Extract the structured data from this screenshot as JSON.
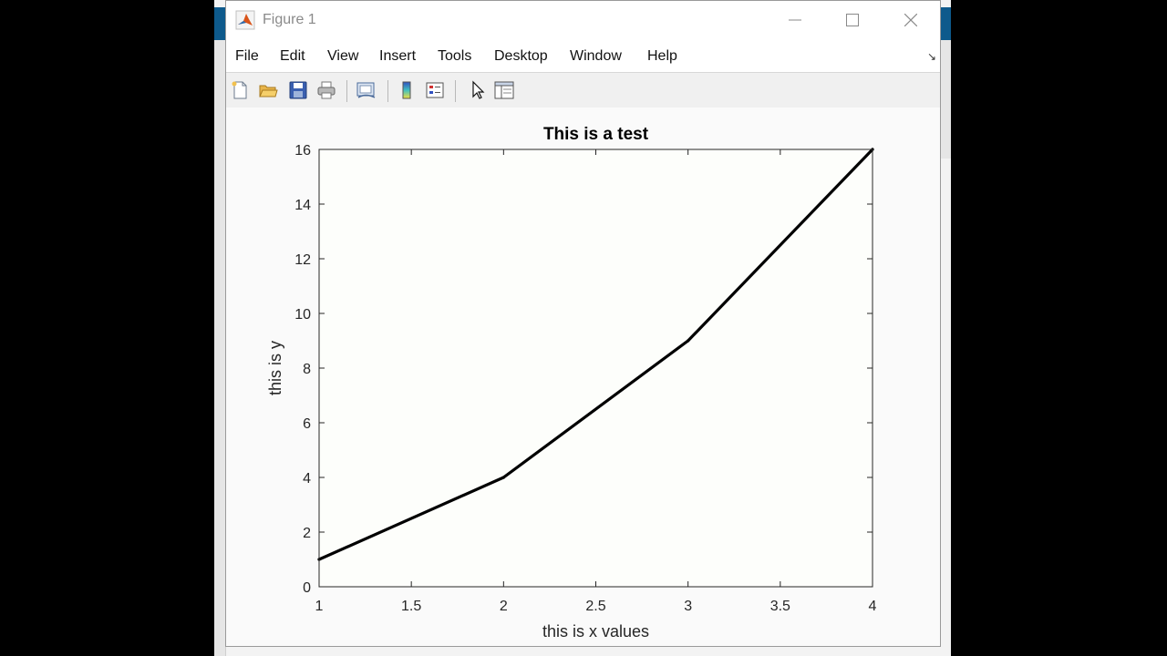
{
  "window": {
    "title": "Figure 1"
  },
  "menu": {
    "items": [
      "File",
      "Edit",
      "View",
      "Insert",
      "Tools",
      "Desktop",
      "Window",
      "Help"
    ],
    "dock_glyph": "↘"
  },
  "toolbar": {
    "buttons": [
      {
        "name": "new-figure-icon"
      },
      {
        "name": "open-file-icon"
      },
      {
        "name": "save-icon"
      },
      {
        "name": "print-icon"
      },
      {
        "name": "link-plot-icon"
      },
      {
        "name": "insert-colorbar-icon"
      },
      {
        "name": "insert-legend-icon"
      },
      {
        "name": "edit-plot-arrow-icon"
      },
      {
        "name": "property-inspector-icon"
      }
    ]
  },
  "chart_data": {
    "type": "line",
    "title": "This is a test",
    "xlabel": "this is x values",
    "ylabel": "this is y",
    "x": [
      1,
      2,
      3,
      4
    ],
    "series": [
      {
        "values": [
          1,
          4,
          9,
          16
        ],
        "color": "#000000"
      }
    ],
    "xlim": [
      1,
      4
    ],
    "ylim": [
      0,
      16
    ],
    "xticks": [
      1,
      1.5,
      2,
      2.5,
      3,
      3.5,
      4
    ],
    "yticks": [
      0,
      2,
      4,
      6,
      8,
      10,
      12,
      14,
      16
    ],
    "grid": false,
    "box": true
  }
}
